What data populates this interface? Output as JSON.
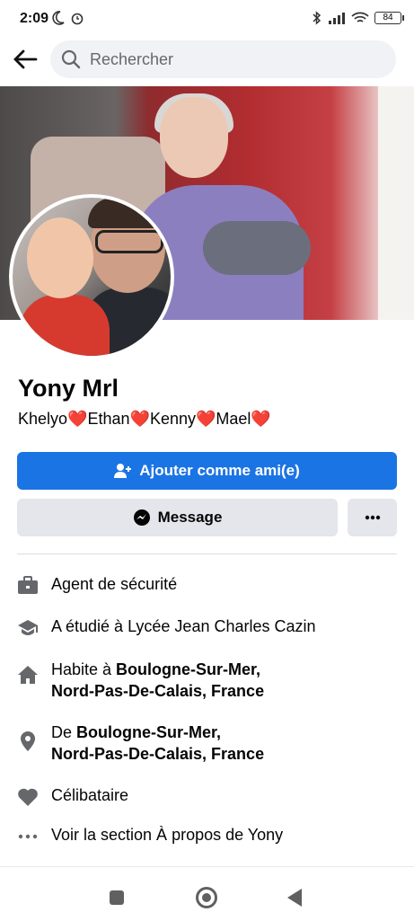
{
  "status_bar": {
    "time": "2:09",
    "battery": "84"
  },
  "search": {
    "placeholder": "Rechercher"
  },
  "profile": {
    "name": "Yony Mrl",
    "bio_parts": [
      "Khelyo",
      "Ethan",
      "Kenny",
      "Mael"
    ],
    "heart": "❤️"
  },
  "buttons": {
    "add_friend": "Ajouter comme ami(e)",
    "message": "Message"
  },
  "info": {
    "job": "Agent de sécurité",
    "education": "A étudié à Lycée Jean Charles Cazin",
    "lives_prefix": "Habite à ",
    "lives_city": "Boulogne-Sur-Mer,",
    "lives_region": "Nord-Pas-De-Calais, France",
    "from_prefix": "De ",
    "from_city": "Boulogne-Sur-Mer,",
    "from_region": "Nord-Pas-De-Calais, France",
    "relationship": "Célibataire",
    "about_link": "Voir la section À propos de Yony"
  },
  "colors": {
    "primary": "#1b74e4",
    "secondary_btn": "#e4e6eb",
    "heart": "#e41e3f"
  }
}
